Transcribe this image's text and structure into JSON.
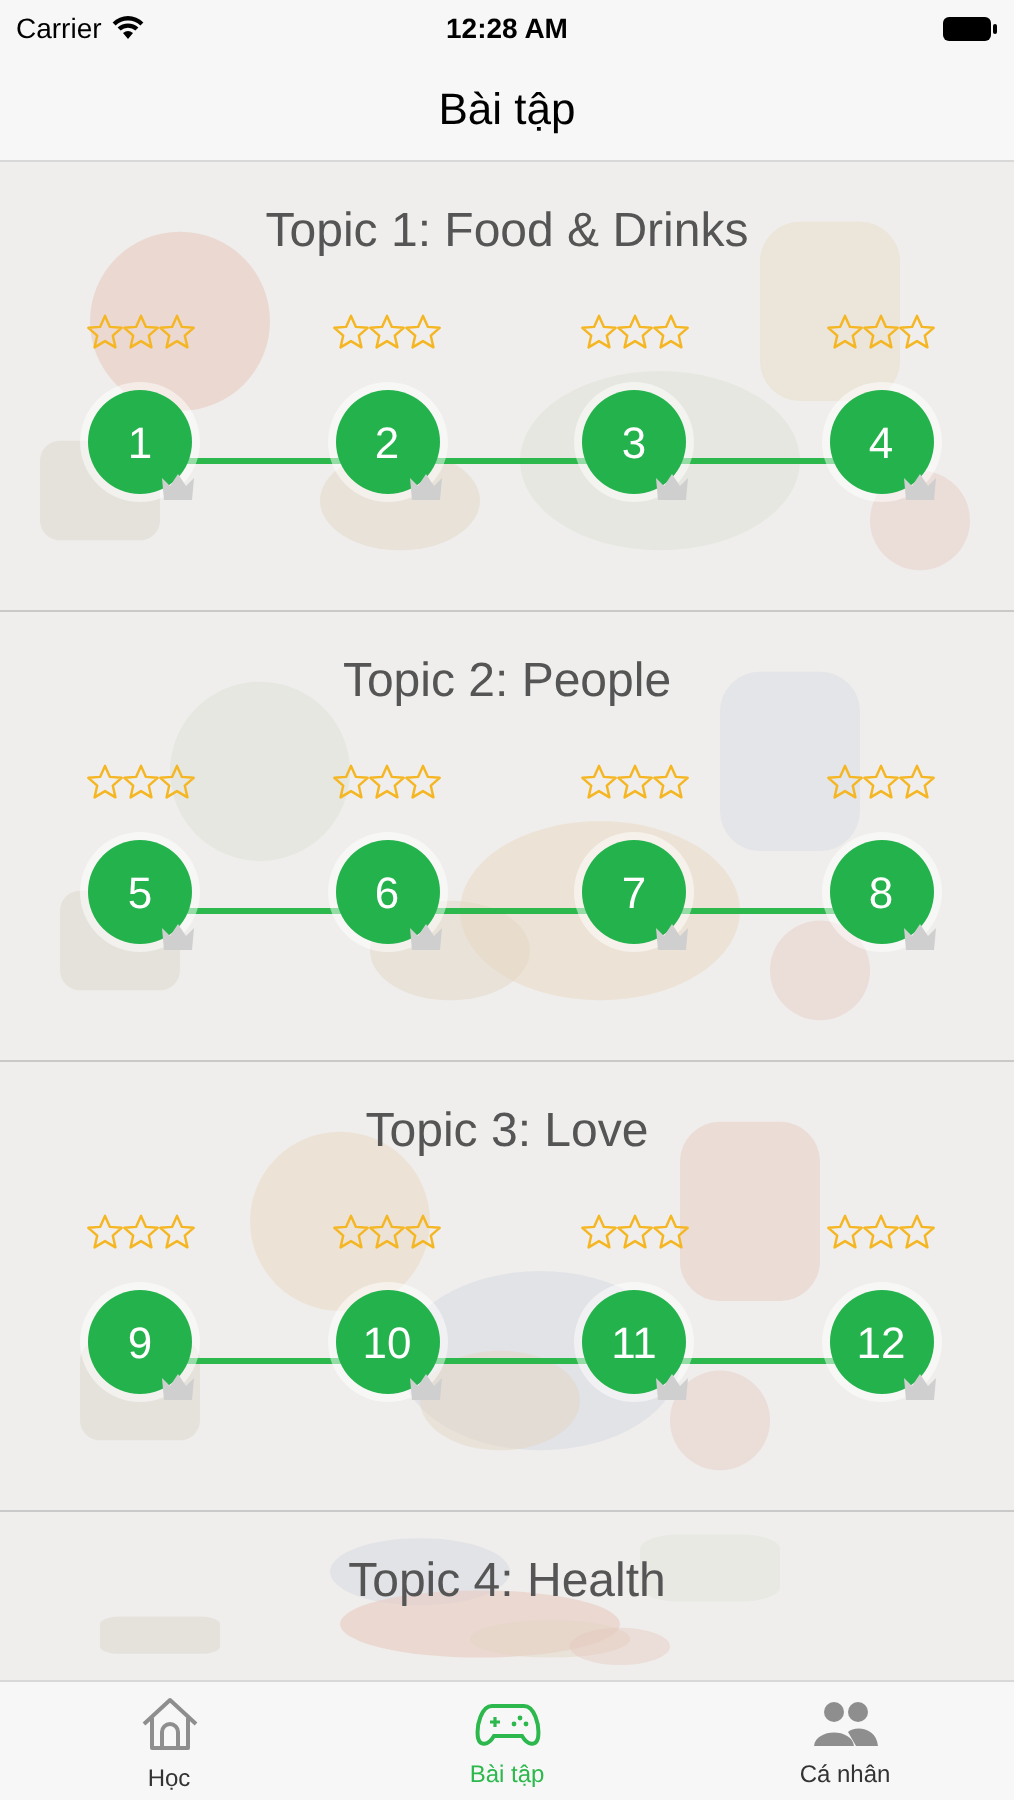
{
  "status_bar": {
    "carrier": "Carrier",
    "time": "12:28 AM"
  },
  "nav": {
    "title": "Bài tập"
  },
  "topics": [
    {
      "title": "Topic 1: Food & Drinks",
      "lessons": [
        {
          "number": "1",
          "stars": 0
        },
        {
          "number": "2",
          "stars": 0
        },
        {
          "number": "3",
          "stars": 0
        },
        {
          "number": "4",
          "stars": 0
        }
      ]
    },
    {
      "title": "Topic 2: People",
      "lessons": [
        {
          "number": "5",
          "stars": 0
        },
        {
          "number": "6",
          "stars": 0
        },
        {
          "number": "7",
          "stars": 0
        },
        {
          "number": "8",
          "stars": 0
        }
      ]
    },
    {
      "title": "Topic 3: Love",
      "lessons": [
        {
          "number": "9",
          "stars": 0
        },
        {
          "number": "10",
          "stars": 0
        },
        {
          "number": "11",
          "stars": 0
        },
        {
          "number": "12",
          "stars": 0
        }
      ]
    },
    {
      "title": "Topic 4: Health"
    }
  ],
  "tabs": [
    {
      "kind": "home",
      "label": "Học",
      "selected": false
    },
    {
      "kind": "gamepad",
      "label": "Bài tập",
      "selected": true
    },
    {
      "kind": "people",
      "label": "Cá nhân",
      "selected": false
    }
  ]
}
